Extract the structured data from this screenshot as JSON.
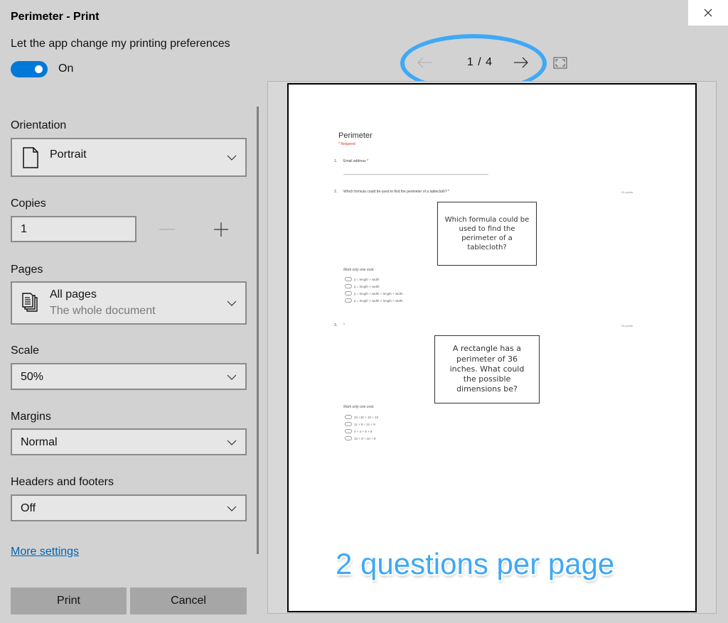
{
  "window": {
    "title": "Perimeter - Print",
    "close_icon": "close-icon"
  },
  "preferences": {
    "label": "Let the app change my printing preferences",
    "toggle_state": "On",
    "toggle_on": true,
    "accent_color": "#0078d7"
  },
  "settings": {
    "orientation": {
      "label": "Orientation",
      "value": "Portrait",
      "icon": "page-icon"
    },
    "copies": {
      "label": "Copies",
      "value": "1",
      "decrement_icon": "minus-icon",
      "increment_icon": "plus-icon"
    },
    "pages": {
      "label": "Pages",
      "value": "All pages",
      "subtext": "The whole document",
      "icon": "pages-icon"
    },
    "scale": {
      "label": "Scale",
      "value": "50%"
    },
    "margins": {
      "label": "Margins",
      "value": "Normal"
    },
    "headers_footers": {
      "label": "Headers and footers",
      "value": "Off"
    },
    "more_settings": "More settings"
  },
  "buttons": {
    "print": "Print",
    "cancel": "Cancel"
  },
  "preview": {
    "current_page": 1,
    "total_pages": 4,
    "page_label": "1 / 4",
    "prev_icon": "arrow-left-icon",
    "next_icon": "arrow-right-icon",
    "fit_icon": "fit-to-window-icon"
  },
  "document": {
    "title": "Perimeter",
    "required_note": "* Required",
    "questions": [
      {
        "number": "1.",
        "text": "Email address *"
      },
      {
        "number": "2.",
        "text": "Which formula could be used to find the perimeter of a tablecloth? *",
        "points": "10 points",
        "card_text": "Which formula could be used to find the perimeter of a tablecloth?",
        "mark_label": "Mark only one oval.",
        "options": [
          "p = length + width",
          "p = length × width",
          "p = length + width + length + width",
          "p = length × width × length × width"
        ]
      },
      {
        "number": "3.",
        "text": "*",
        "points": "10 points",
        "card_text": "A rectangle has a perimeter of 36 inches. What could the possible dimensions be?",
        "mark_label": "Mark only one oval.",
        "options": [
          "10 +10 + 10 + 10",
          "11 + 8 + 11 + 8",
          "4 + 4 + 9 + 9",
          "10 + 8 + 10 + 8"
        ]
      }
    ]
  },
  "annotation": {
    "text": "2 questions per page",
    "color": "#3fa9f5"
  }
}
